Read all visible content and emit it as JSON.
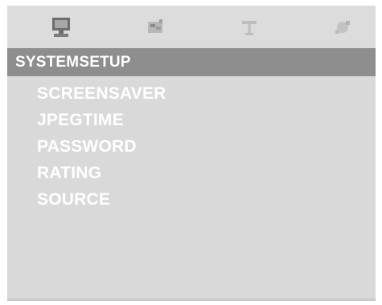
{
  "tabs": [
    {
      "icon": "system-setup-icon"
    },
    {
      "icon": "language-icon"
    },
    {
      "icon": "audio-icon"
    },
    {
      "icon": "video-icon"
    }
  ],
  "title": "SYSTEMSETUP",
  "menu": [
    {
      "label": "SCREENSAVER"
    },
    {
      "label": "JPEGTIME"
    },
    {
      "label": "PASSWORD"
    },
    {
      "label": "RATING"
    },
    {
      "label": "SOURCE"
    }
  ]
}
